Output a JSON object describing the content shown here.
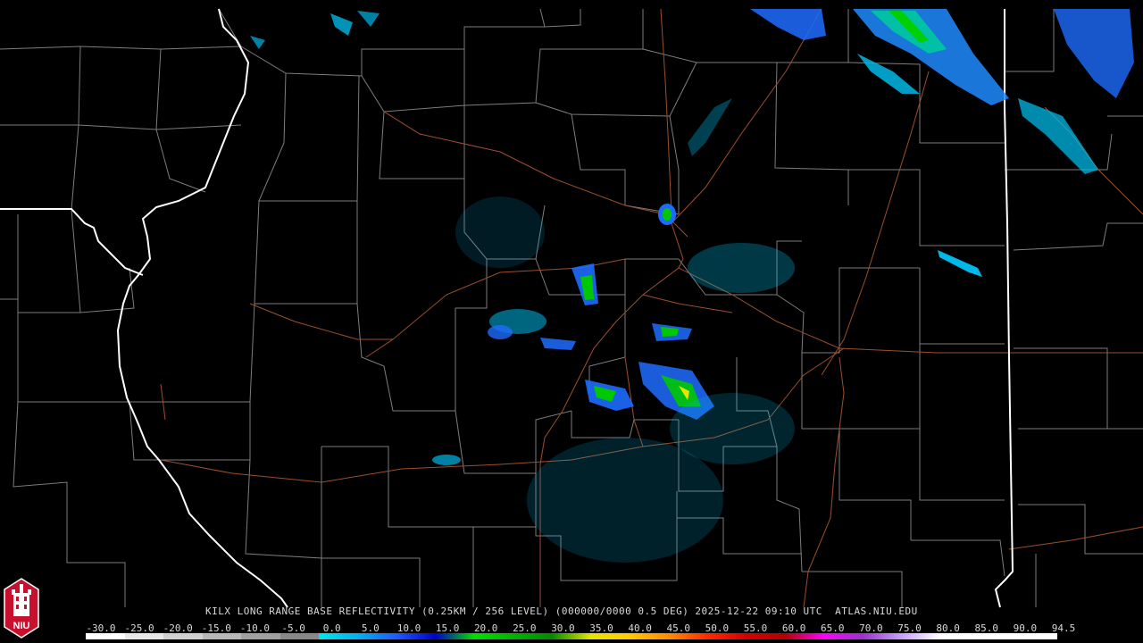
{
  "product_caption": "KILX LONG RANGE BASE REFLECTIVITY (0.25KM / 256 LEVEL) (000000/0000 0.5 DEG) 2025-12-22 09:10 UTC  ATLAS.NIU.EDU",
  "logo": {
    "text": "NIU",
    "icon": "niu-tower-logo-icon",
    "bg": "#c8102e"
  },
  "colors": {
    "background": "#000000",
    "county_lines": "#8a8a8a",
    "state_lines": "#ffffff",
    "highways": "#a0522d"
  },
  "scale": {
    "labels": [
      "-30.0",
      "-25.0",
      "-20.0",
      "-15.0",
      "-10.0",
      "-5.0",
      "0.0",
      "5.0",
      "10.0",
      "15.0",
      "20.0",
      "25.0",
      "30.0",
      "35.0",
      "40.0",
      "45.0",
      "50.0",
      "55.0",
      "60.0",
      "65.0",
      "70.0",
      "75.0",
      "80.0",
      "85.0",
      "90.0",
      "94.5"
    ],
    "colors": [
      "#ffffff",
      "#e8e8e8",
      "#d0d0d0",
      "#b8b8b8",
      "#a0a0a0",
      "#888888",
      "#00e5ee",
      "#00b2ee",
      "#1e5aff",
      "#0000c8",
      "#00e000",
      "#00b400",
      "#008c00",
      "#e6e600",
      "#ffc800",
      "#ff8c00",
      "#ff2a00",
      "#d40000",
      "#b40000",
      "#ff00ff",
      "#9a32cd",
      "#c8a0ff",
      "#ffffff",
      "#ffffff",
      "#ffffff"
    ]
  }
}
